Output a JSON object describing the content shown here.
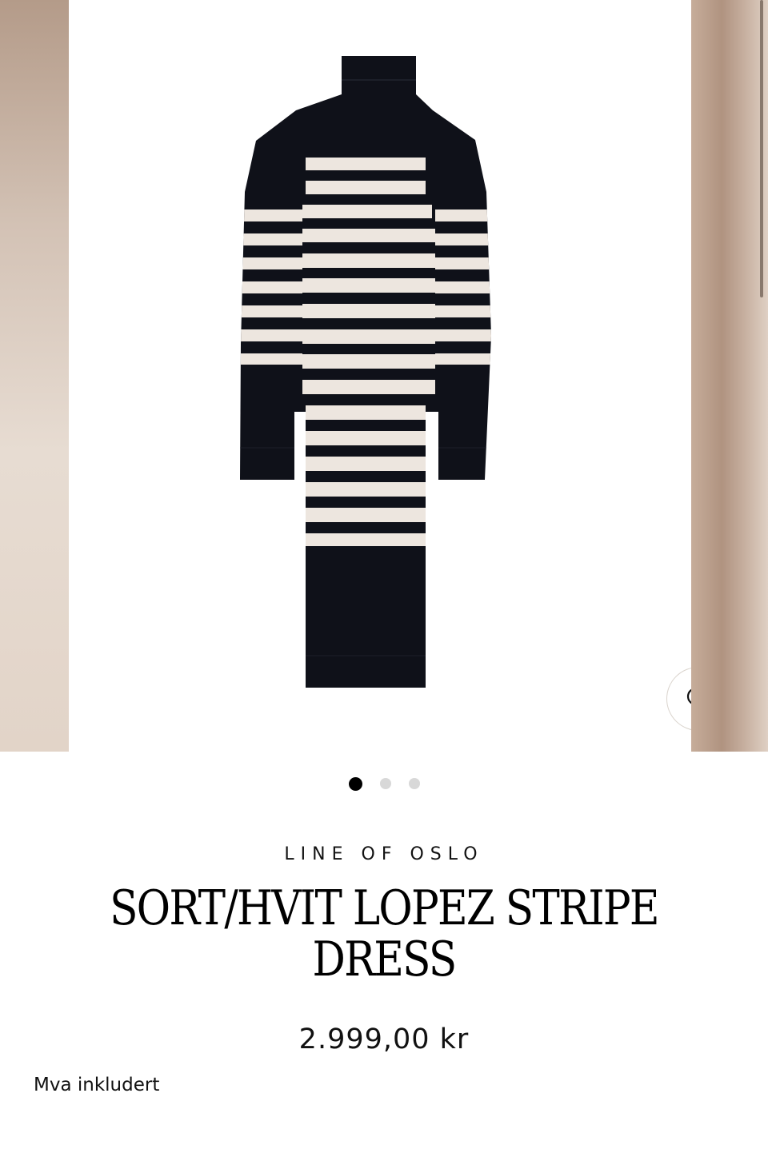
{
  "product": {
    "brand": "LINE OF OSLO",
    "title": "SORT/HVIT LOPEZ STRIPE DRESS",
    "price": "2.999,00 kr",
    "vat_note": "Mva inkludert"
  },
  "gallery": {
    "image_count": 3,
    "active_index": 0,
    "zoom_icon": "magnifier-icon"
  },
  "colors": {
    "dress_dark": "#0f1119",
    "dress_stripe": "#ede6df",
    "dot_active": "#000000",
    "dot_inactive": "#d8d8d8"
  }
}
